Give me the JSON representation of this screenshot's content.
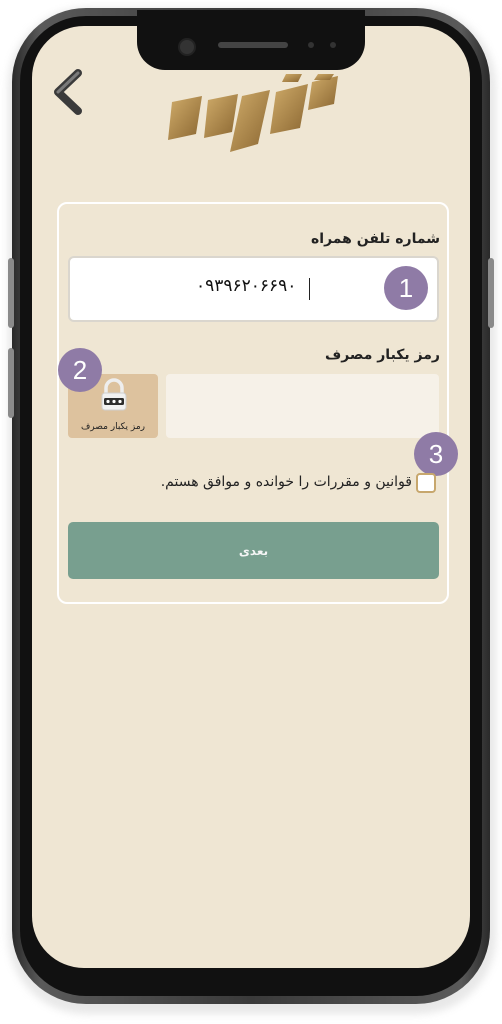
{
  "form": {
    "phone_label": "شماره تلفن همراه",
    "phone_value": "۰۹۳۹۶۲۰۶۶۹۰",
    "otp_label": "رمز یکبار مصرف",
    "otp_button_label": "رمز یکبار مصرف",
    "otp_value": "",
    "terms_text": "قوانین و مقررات را خوانده و موافق هستم.",
    "terms_checked": false,
    "next_label": "بعدی"
  },
  "badges": {
    "one": "1",
    "two": "2",
    "three": "3"
  },
  "icons": {
    "back": "chevron-left-icon",
    "otp": "lock-icon"
  },
  "colors": {
    "screen_bg": "#efe6d3",
    "logo_gold": "#b8924f",
    "badge": "#8f7ba6",
    "next_button": "#789f8f",
    "otp_button": "#ddc29e"
  }
}
